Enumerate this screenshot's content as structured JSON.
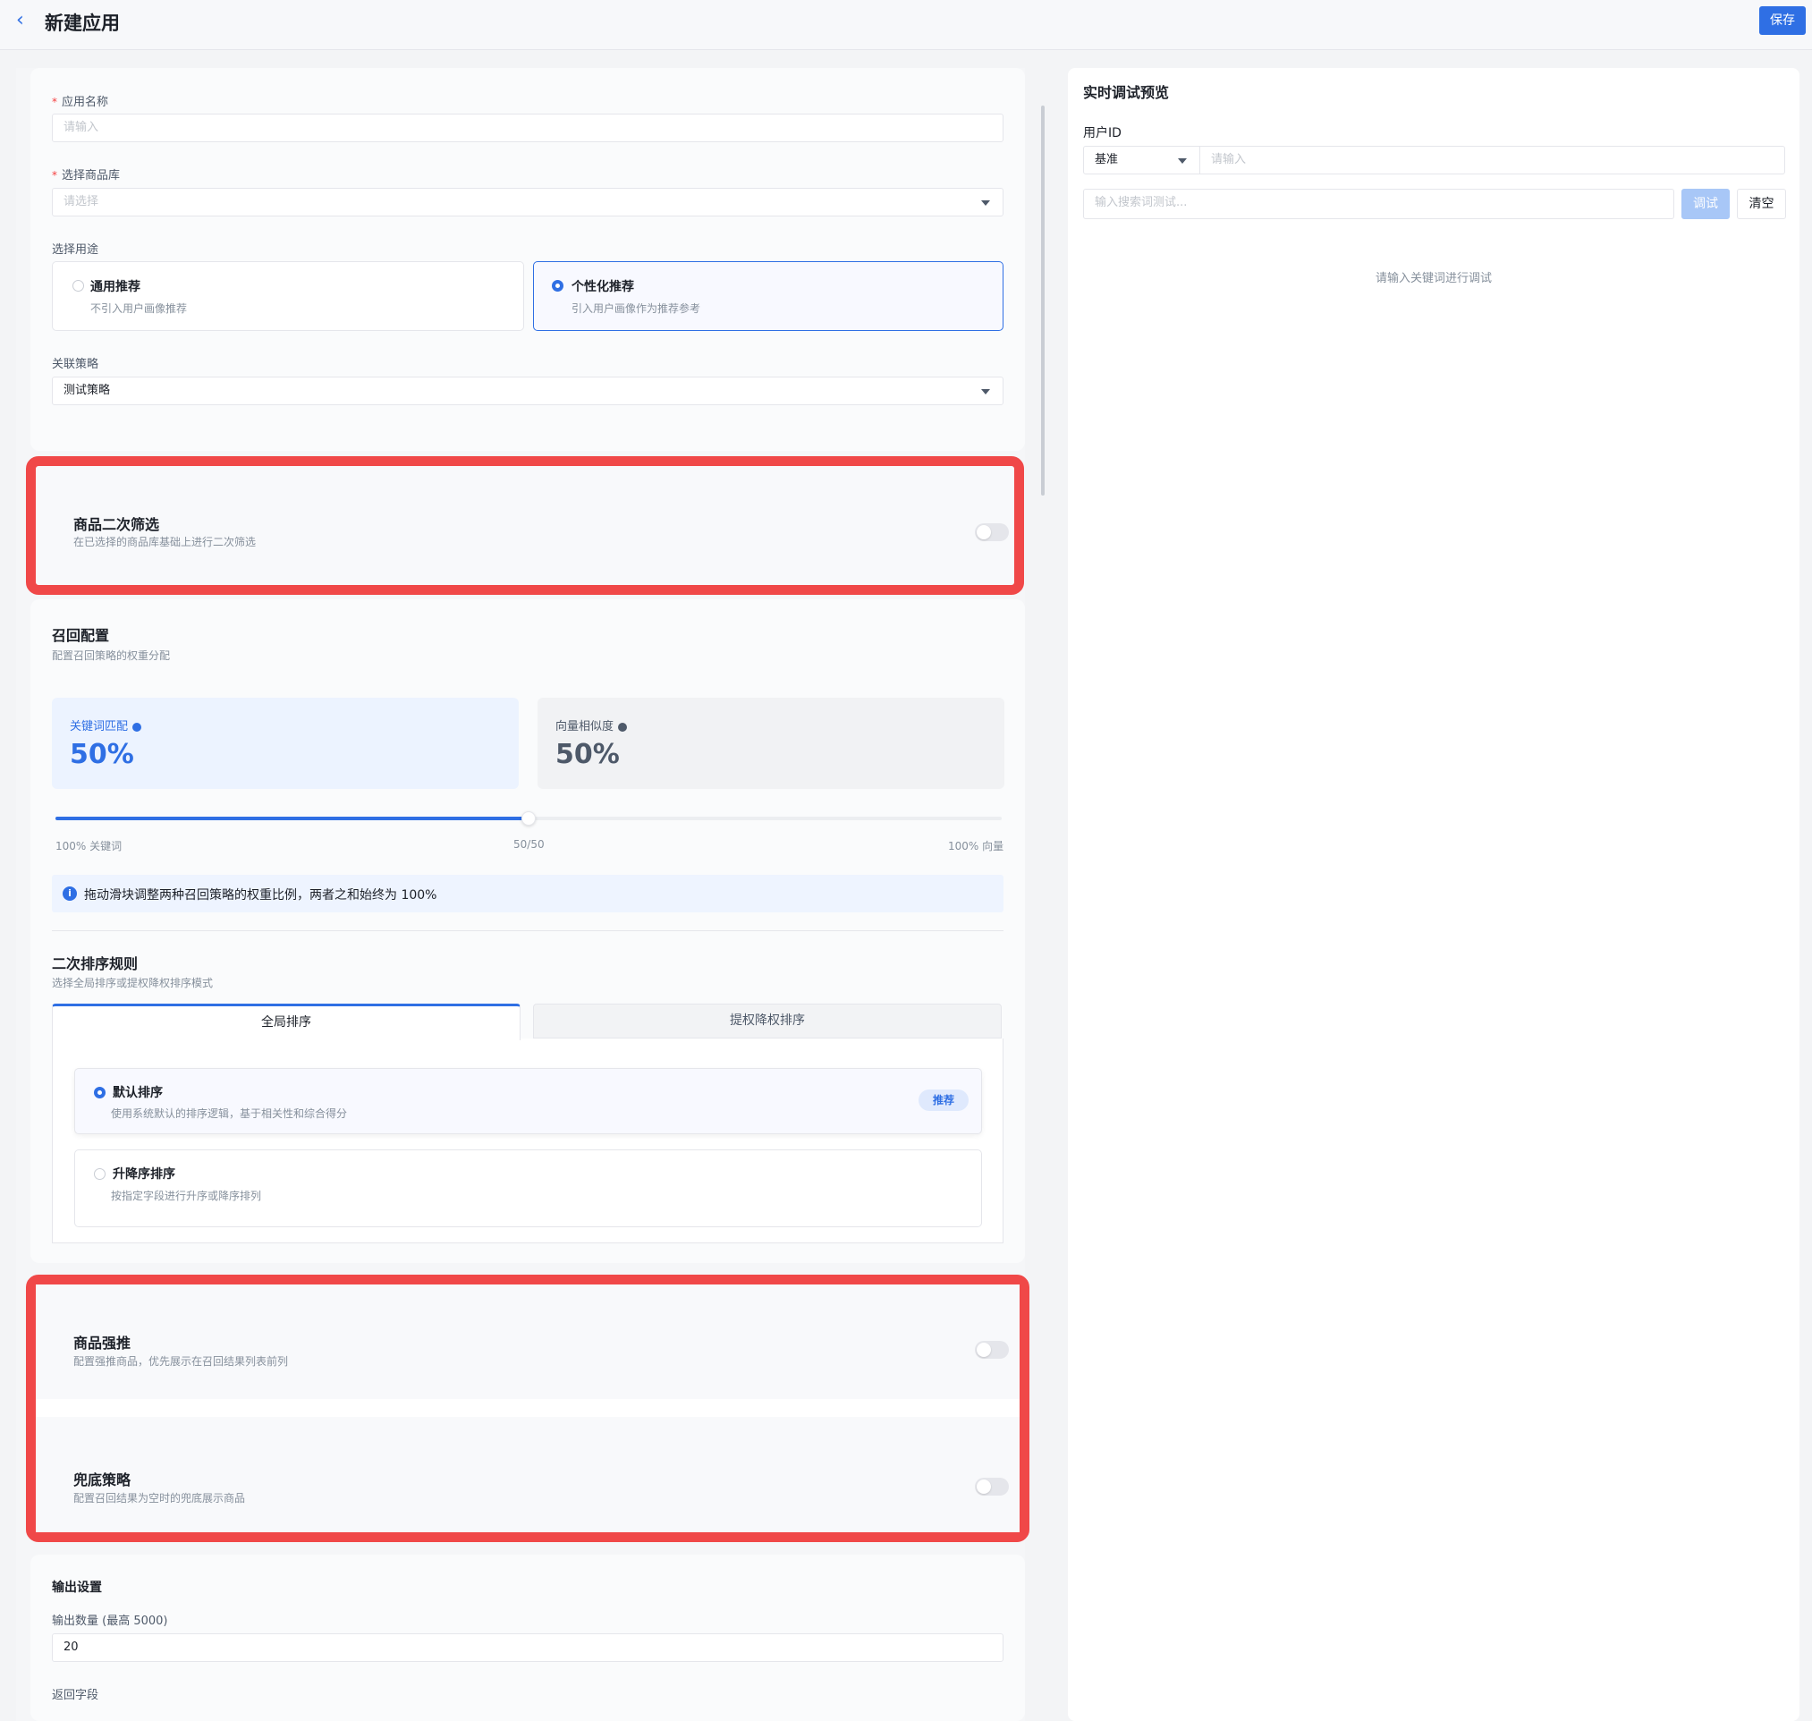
{
  "header": {
    "back_icon": "chevron-left-icon",
    "title": "新建应用",
    "save_label": "保存"
  },
  "form": {
    "app_name_label": "应用名称",
    "app_name_placeholder": "请输入",
    "library_label": "选择商品库",
    "library_placeholder": "请选择",
    "purpose_label": "选择用途",
    "purpose_options": [
      {
        "title": "通用推荐",
        "desc": "不引入用户画像推荐",
        "selected": false
      },
      {
        "title": "个性化推荐",
        "desc": "引入用户画像作为推荐参考",
        "selected": true
      }
    ],
    "strategy_label": "关联策略",
    "strategy_value": "测试策略"
  },
  "secondary_filter": {
    "title": "商品二次筛选",
    "desc": "在已选择的商品库基础上进行二次筛选",
    "enabled": false
  },
  "recall": {
    "title": "召回配置",
    "desc": "配置召回策略的权重分配",
    "keyword": {
      "label": "关键词匹配",
      "value": "50%"
    },
    "vector": {
      "label": "向量相似度",
      "value": "50%"
    },
    "slider": {
      "value": 0.5,
      "left_label": "100% 关键词",
      "mid_label": "50/50",
      "right_label": "100% 向量"
    },
    "info": "拖动滑块调整两种召回策略的权重比例，两者之和始终为 100%"
  },
  "rerank": {
    "title": "二次排序规则",
    "desc": "选择全局排序或提权降权排序模式",
    "tabs": [
      "全局排序",
      "提权降权排序"
    ],
    "active_tab": 0,
    "options": [
      {
        "title": "默认排序",
        "desc": "使用系统默认的排序逻辑，基于相关性和综合得分",
        "badge": "推荐",
        "selected": true
      },
      {
        "title": "升降序排序",
        "desc": "按指定字段进行升序或降序排列",
        "selected": false
      }
    ]
  },
  "boost": {
    "title": "商品强推",
    "desc": "配置强推商品，优先展示在召回结果列表前列",
    "enabled": false
  },
  "fallback": {
    "title": "兜底策略",
    "desc": "配置召回结果为空时的兜底展示商品",
    "enabled": false
  },
  "output": {
    "title": "输出设置",
    "count_label": "输出数量 (最高 5000)",
    "count_value": "20",
    "fields_label": "返回字段"
  },
  "preview": {
    "title": "实时调试预览",
    "user_label": "用户ID",
    "mode_value": "基准",
    "user_placeholder": "请输入",
    "search_placeholder": "输入搜索词测试...",
    "debug_label": "调试",
    "clear_label": "清空",
    "empty_text": "请输入关键词进行调试"
  },
  "colors": {
    "accent": "#2f6fe4",
    "highlight": "#f04848"
  }
}
